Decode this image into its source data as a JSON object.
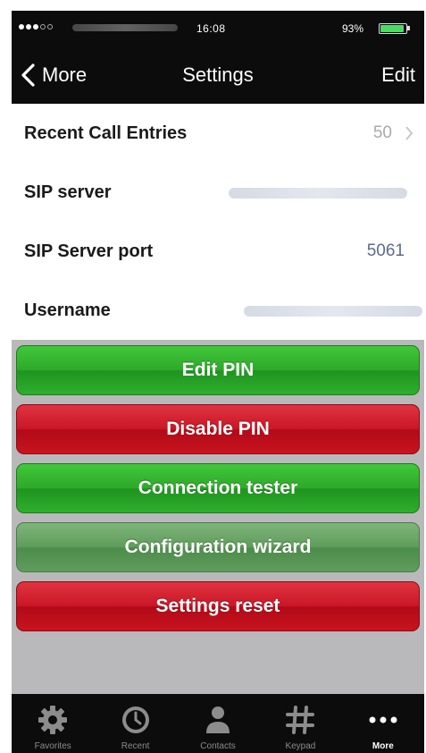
{
  "status_bar": {
    "time": "16:08",
    "battery_percent": "93%",
    "battery_level": 0.93,
    "signal_bars_filled": 3,
    "signal_bars_total": 5,
    "battery_color": "#4cd964"
  },
  "nav": {
    "back_label": "More",
    "title": "Settings",
    "edit_label": "Edit"
  },
  "settings": {
    "recent_calls": {
      "label": "Recent Call Entries",
      "value": "50"
    },
    "sip_server": {
      "label": "SIP server"
    },
    "sip_port": {
      "label": "SIP Server port",
      "value": "5061"
    },
    "username": {
      "label": "Username"
    }
  },
  "buttons": {
    "edit_pin": {
      "label": "Edit PIN",
      "color": "#2ea82a"
    },
    "disable_pin": {
      "label": "Disable PIN",
      "color": "#c91626"
    },
    "connection_tester": {
      "label": "Connection tester",
      "color": "#2ea82a"
    },
    "config_wizard": {
      "label": "Configuration wizard",
      "color": "#5e9c5a"
    },
    "settings_reset": {
      "label": "Settings reset",
      "color": "#c91626"
    }
  },
  "tabs": [
    {
      "label": "Favorites",
      "icon": "gear-icon"
    },
    {
      "label": "Recent",
      "icon": "clock-icon"
    },
    {
      "label": "Contacts",
      "icon": "person-icon"
    },
    {
      "label": "Keypad",
      "icon": "hash-icon"
    },
    {
      "label": "More",
      "icon": "more-dots-icon",
      "active": true
    }
  ]
}
